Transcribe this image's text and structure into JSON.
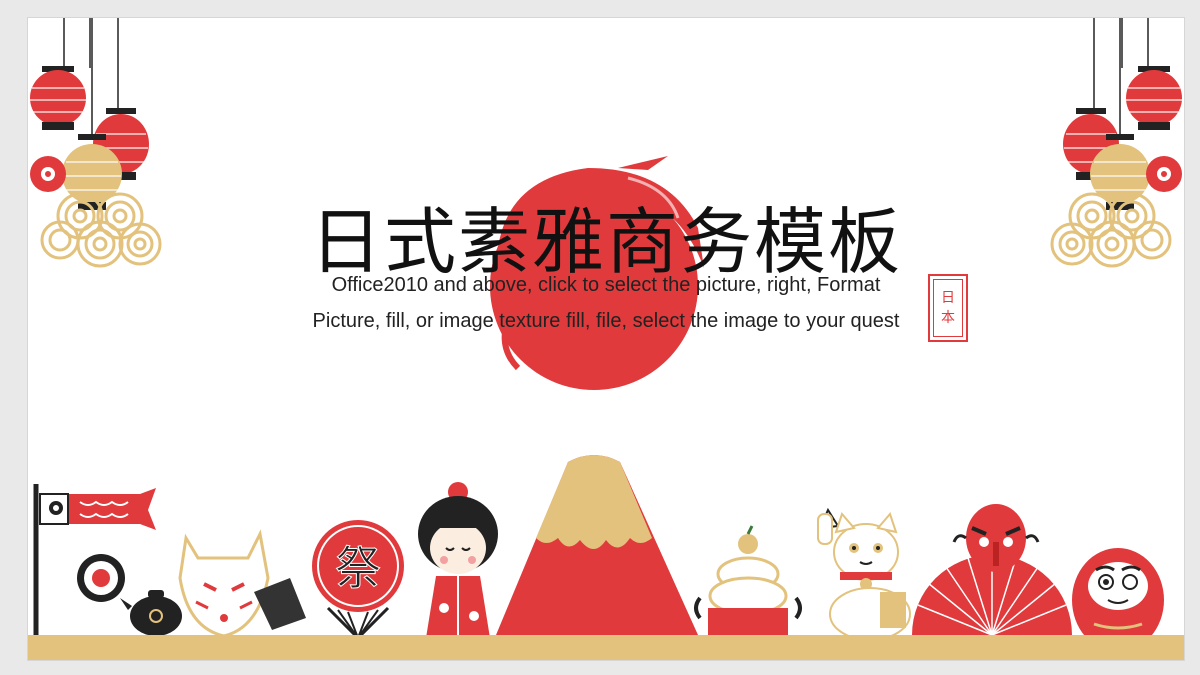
{
  "slide": {
    "title": "日式素雅商务模板",
    "subtitle_line1": "Office2010 and above, click to select the picture, right, Format",
    "subtitle_line2": "Picture, fill, or image texture fill, file, select the image to your quest",
    "stamp_text": [
      "日",
      "本"
    ]
  },
  "palette": {
    "red": "#e03a3c",
    "gold": "#e2c27c",
    "black": "#222222",
    "white": "#ffffff"
  },
  "decorations": {
    "icons": [
      "lantern-icon",
      "plum-blossom-icon",
      "wave-cloud-icon",
      "carp-streamer-icon",
      "kitsune-mask-icon",
      "festival-fan-icon",
      "kokeshi-doll-icon",
      "mount-fuji-icon",
      "kagami-mochi-icon",
      "maneki-neko-icon",
      "folding-fan-icon",
      "tengu-mask-icon",
      "daruma-icon",
      "sushi-roll-icon",
      "teapot-icon",
      "ink-sun-icon"
    ]
  }
}
